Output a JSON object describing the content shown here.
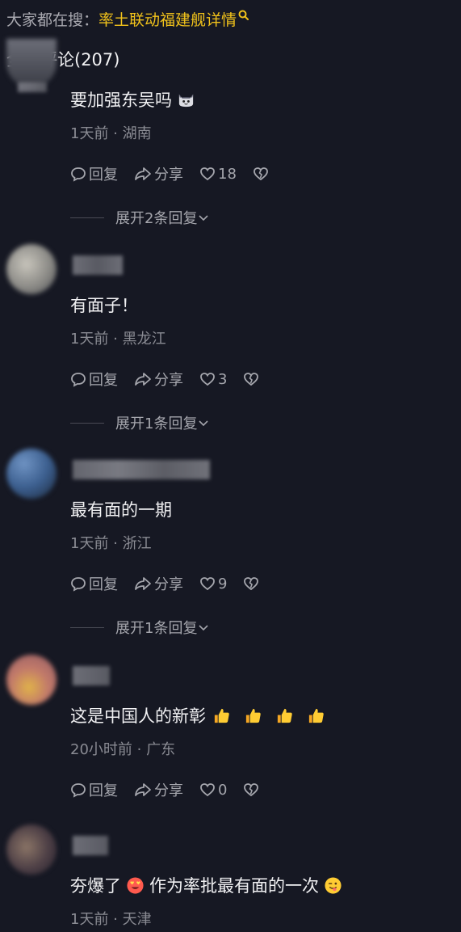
{
  "search_hint": {
    "prefix": "大家都在搜：",
    "query": "率土联动福建舰详情"
  },
  "comments_header": "全部评论(207)",
  "comments": [
    {
      "text": "要加强东吴吗",
      "emoji": [
        "cat-face"
      ],
      "time": "1天前",
      "location": "湖南",
      "reply_label": "回复",
      "share_label": "分享",
      "likes": "18",
      "expand_label": "展开2条回复"
    },
    {
      "text": "有面子！",
      "emoji": [],
      "time": "1天前",
      "location": "黑龙江",
      "reply_label": "回复",
      "share_label": "分享",
      "likes": "3",
      "expand_label": "展开1条回复"
    },
    {
      "text": "最有面的一期",
      "emoji": [],
      "time": "1天前",
      "location": "浙江",
      "reply_label": "回复",
      "share_label": "分享",
      "likes": "9",
      "expand_label": "展开1条回复"
    },
    {
      "text": "这是中国人的新彰",
      "emoji": [
        "thumbs-up",
        "thumbs-up",
        "thumbs-up",
        "thumbs-up"
      ],
      "time": "20小时前",
      "location": "广东",
      "reply_label": "回复",
      "share_label": "分享",
      "likes": "0"
    },
    {
      "text_before": "夯爆了",
      "text_after": "作为率批最有面的一次",
      "emoji": [
        "heart-eyes",
        "tongue-wink"
      ],
      "time": "1天前",
      "location": "天津"
    }
  ],
  "meta_separator": " · ",
  "colors": {
    "background": "#161823",
    "search_query": "#f1c21b",
    "text_primary": "#f1f1f3",
    "text_secondary": "#8a8b93"
  }
}
